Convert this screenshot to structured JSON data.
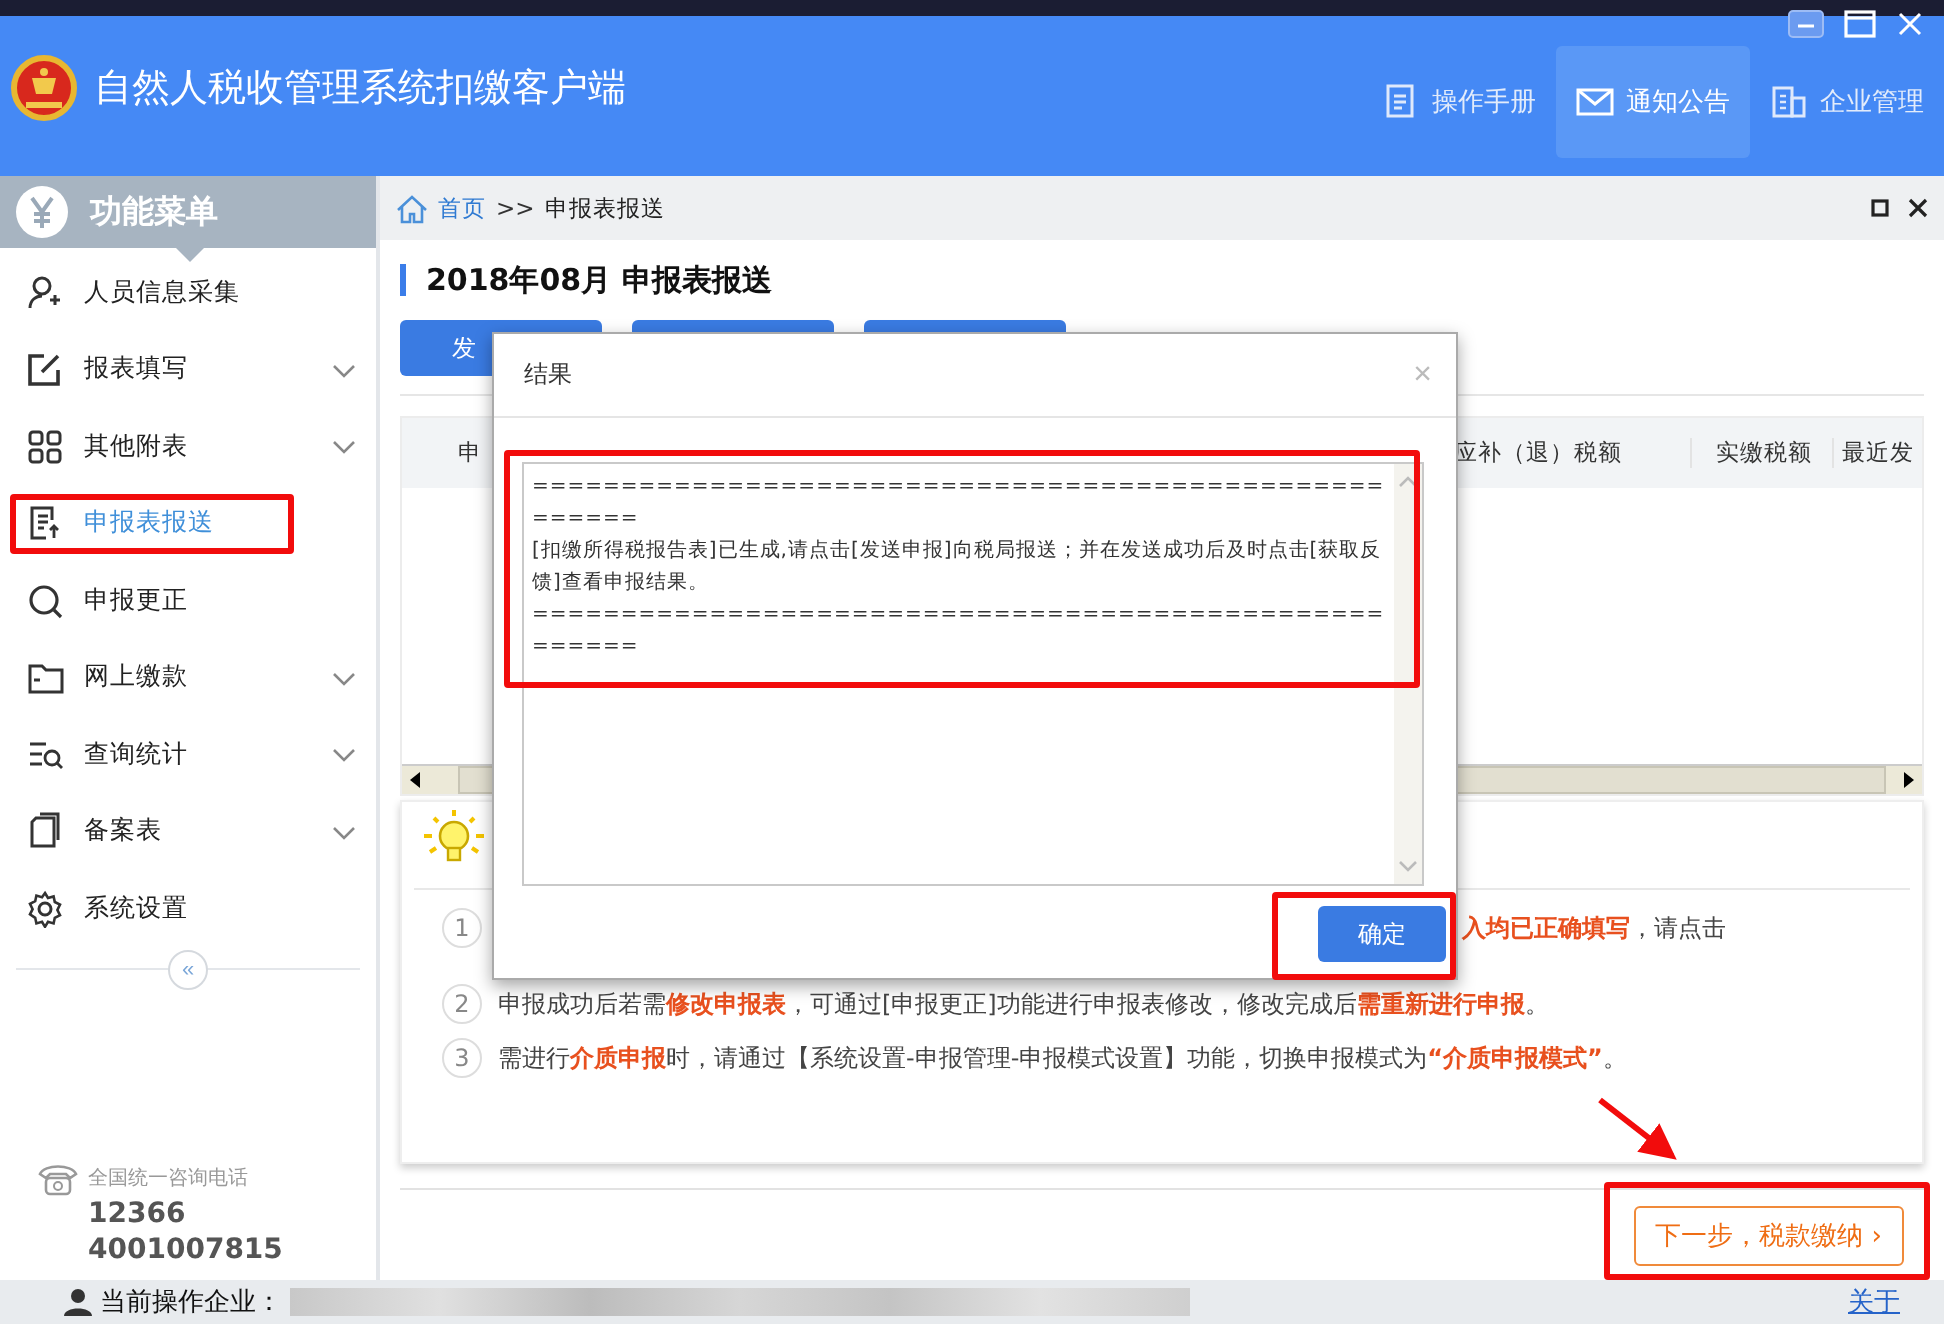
{
  "app": {
    "title": "自然人税收管理系统扣缴客户端"
  },
  "header_nav": [
    {
      "label": "操作手册",
      "selected": false
    },
    {
      "label": "通知公告",
      "selected": true
    },
    {
      "label": "企业管理",
      "selected": false
    }
  ],
  "sidebar": {
    "title": "功能菜单",
    "items": [
      {
        "label": "人员信息采集",
        "expandable": false,
        "selected": false
      },
      {
        "label": "报表填写",
        "expandable": true,
        "selected": false
      },
      {
        "label": "其他附表",
        "expandable": true,
        "selected": false
      },
      {
        "label": "申报表报送",
        "expandable": false,
        "selected": true
      },
      {
        "label": "申报更正",
        "expandable": false,
        "selected": false
      },
      {
        "label": "网上缴款",
        "expandable": true,
        "selected": false
      },
      {
        "label": "查询统计",
        "expandable": true,
        "selected": false
      },
      {
        "label": "备案表",
        "expandable": true,
        "selected": false
      },
      {
        "label": "系统设置",
        "expandable": false,
        "selected": false
      }
    ],
    "collapse": "«",
    "hotline_label": "全国统一咨询电话",
    "hotlines": [
      "12366",
      "4001007815"
    ]
  },
  "breadcrumb": {
    "home": "首页",
    "separator": ">>",
    "current": "申报表报送"
  },
  "page": {
    "title": "2018年08月  申报表报送",
    "buttons": [
      "发"
    ],
    "table": {
      "columns": [
        "申",
        "应补（退）税额",
        "实缴税额",
        "最近发"
      ]
    },
    "tips": [
      {
        "number": "1",
        "fragments": [
          "**入均已正确填写**，请点击"
        ]
      },
      {
        "number": "2",
        "text": "申报成功后若需**修改申报表**，可通过[申报更正]功能进行申报表修改，修改完成后**需重新进行申报**。"
      },
      {
        "number": "3",
        "text": "需进行**介质申报**时，请通过【系统设置-申报管理-申报模式设置】功能，切换申报模式为**“介质申报模式”**。"
      }
    ],
    "next_button": "下一步，税款缴纳",
    "next_icon": "›"
  },
  "dialog": {
    "title": "结果",
    "close": "×",
    "lines": [
      "======================================================",
      "[扣缴所得税报告表]已生成,请点击[发送申报]向税局报送；并在发送成功后及时点击[获取反馈]查看申报结果。",
      "======================================================"
    ],
    "confirm": "确定"
  },
  "status_bar": {
    "label": "当前操作企业：",
    "about": "关于"
  }
}
